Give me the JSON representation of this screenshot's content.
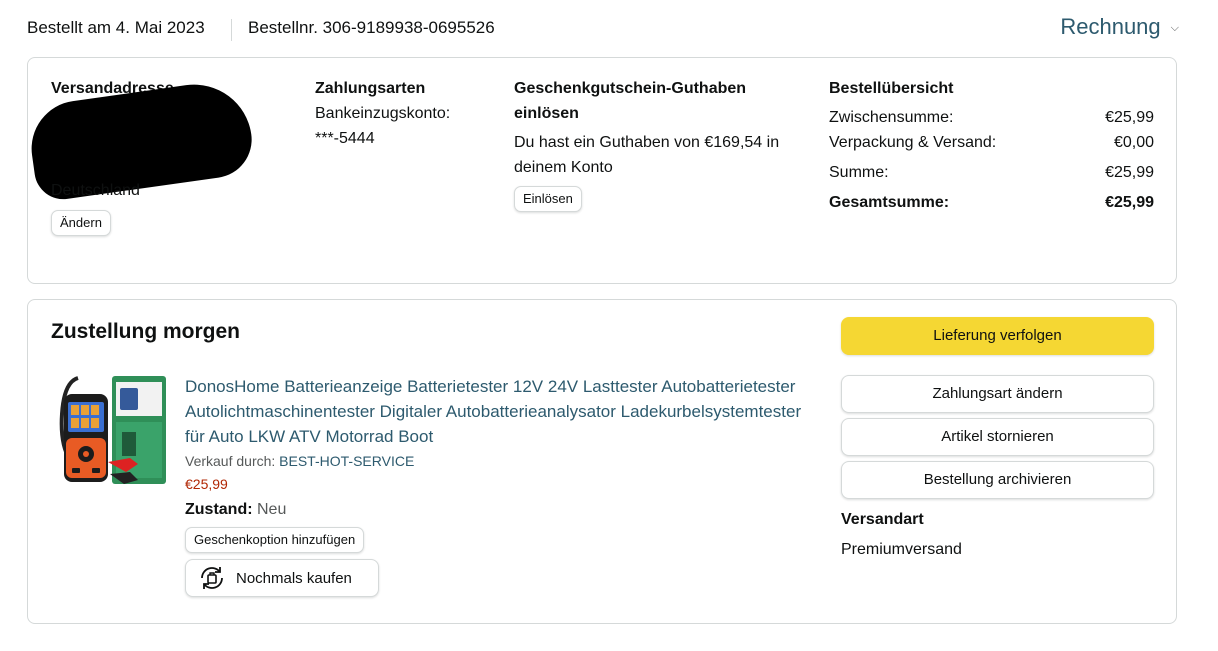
{
  "header": {
    "ordered": "Bestellt am 4. Mai 2023",
    "order_number": "Bestellnr. 306-9189938-0695526",
    "invoice_label": "Rechnung"
  },
  "address": {
    "title": "Versandadresse",
    "country": "Deutschland",
    "change_button": "Ändern"
  },
  "payment": {
    "title": "Zahlungsarten",
    "method": "Bankeinzugskonto:",
    "account": "***-5444"
  },
  "gift": {
    "title": "Geschenkgutschein-Guthaben einlösen",
    "text": "Du hast ein Guthaben von €169,54 in deinem Konto",
    "redeem_button": "Einlösen"
  },
  "summary": {
    "title": "Bestellübersicht",
    "rows": [
      {
        "label": "Zwischensumme:",
        "value": "€25,99"
      },
      {
        "label": "Verpackung & Versand:",
        "value": "€0,00"
      },
      {
        "label": "Summe:",
        "value": "€25,99"
      },
      {
        "label": "Gesamtsumme:",
        "value": "€25,99"
      }
    ]
  },
  "delivery": {
    "title": "Zustellung morgen",
    "product": {
      "title": "DonosHome Batterieanzeige Batterietester 12V 24V Lasttester Autobatterietester Autolichtmaschinentester Digitaler Autobatterieanalysator Ladekurbelsystemtester für Auto LKW ATV Motorrad Boot",
      "seller_prefix": "Verkauf durch:",
      "seller": "BEST-HOT-SERVICE",
      "price": "€25,99",
      "condition_label": "Zustand:",
      "condition_value": "Neu",
      "gift_button": "Geschenkoption hinzufügen",
      "buy_again_button": "Nochmals kaufen",
      "buy_again_icon": "buy-again-icon"
    },
    "actions": {
      "track": "Lieferung verfolgen",
      "change_payment": "Zahlungsart ändern",
      "cancel": "Artikel stornieren",
      "archive": "Bestellung archivieren"
    },
    "shipping_label": "Versandart",
    "shipping_value": "Premiumversand"
  },
  "colors": {
    "link": "#2d5a6e",
    "price": "#b12704",
    "primary_button": "#f5d733",
    "border": "#d5d9d9"
  }
}
